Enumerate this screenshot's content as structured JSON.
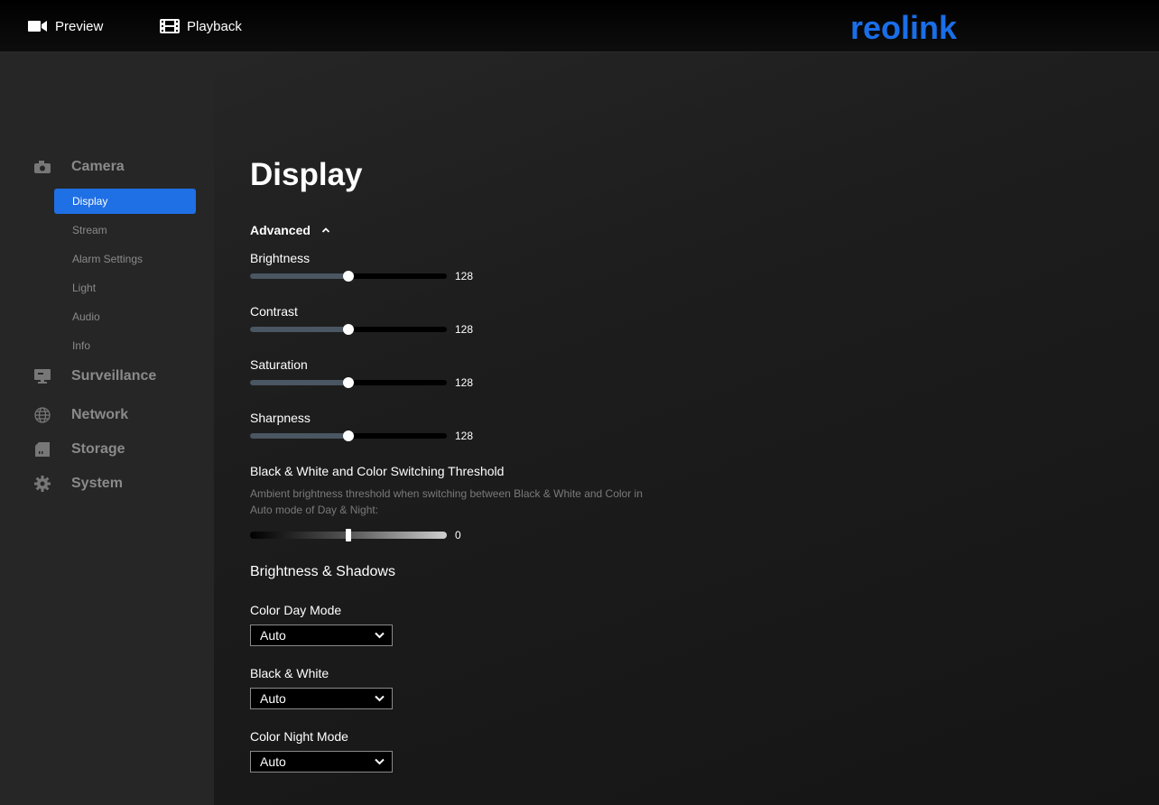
{
  "topbar": {
    "preview_label": "Preview",
    "playback_label": "Playback",
    "logo_text": "reolink",
    "logo_color": "#1a6ee8"
  },
  "sidebar": {
    "sections": [
      {
        "label": "Camera",
        "icon": "camera-icon"
      },
      {
        "label": "Surveillance",
        "icon": "monitor-icon"
      },
      {
        "label": "Network",
        "icon": "globe-icon"
      },
      {
        "label": "Storage",
        "icon": "sd-card-icon"
      },
      {
        "label": "System",
        "icon": "gear-icon"
      }
    ],
    "camera_items": [
      {
        "label": "Display",
        "active": true
      },
      {
        "label": "Stream"
      },
      {
        "label": "Alarm Settings"
      },
      {
        "label": "Light"
      },
      {
        "label": "Audio"
      },
      {
        "label": "Info"
      }
    ],
    "active_color": "#1f6fe5"
  },
  "main": {
    "title": "Display",
    "advanced_label": "Advanced",
    "sliders": [
      {
        "label": "Brightness",
        "value": "128",
        "fraction": 0.5
      },
      {
        "label": "Contrast",
        "value": "128",
        "fraction": 0.5
      },
      {
        "label": "Saturation",
        "value": "128",
        "fraction": 0.5
      },
      {
        "label": "Sharpness",
        "value": "128",
        "fraction": 0.5
      }
    ],
    "threshold": {
      "title": "Black & White and Color Switching Threshold",
      "description": "Ambient brightness threshold when switching between Black & White and Color in Auto mode of Day & Night:",
      "value": "0",
      "fraction": 0.5
    },
    "shadows_heading": "Brightness & Shadows",
    "selects": [
      {
        "label": "Color Day Mode",
        "value": "Auto"
      },
      {
        "label": "Black & White",
        "value": "Auto"
      },
      {
        "label": "Color Night Mode",
        "value": "Auto"
      }
    ]
  }
}
